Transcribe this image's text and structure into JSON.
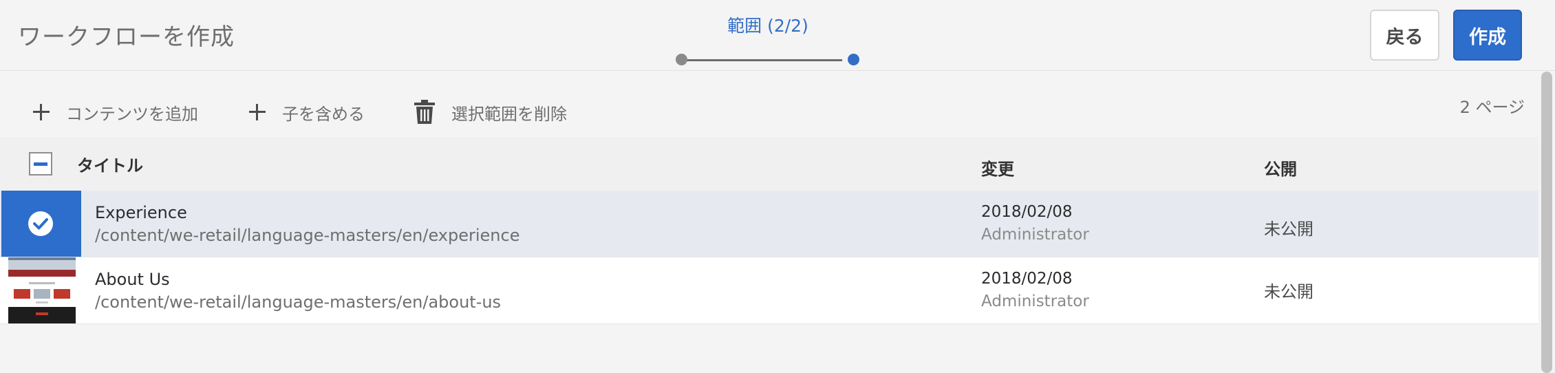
{
  "header": {
    "title": "ワークフローを作成",
    "step_label": "範囲 (2/2)",
    "back_label": "戻る",
    "create_label": "作成"
  },
  "toolbar": {
    "add_content": "コンテンツを追加",
    "include_children": "子を含める",
    "delete_selection": "選択範囲を削除",
    "page_count": "2 ページ"
  },
  "table": {
    "columns": {
      "title": "タイトル",
      "modified": "変更",
      "published": "公開"
    },
    "rows": [
      {
        "title": "Experience",
        "path": "/content/we-retail/language-masters/en/experience",
        "date": "2018/02/08",
        "user": "Administrator",
        "status": "未公開",
        "selected": true
      },
      {
        "title": "About Us",
        "path": "/content/we-retail/language-masters/en/about-us",
        "date": "2018/02/08",
        "user": "Administrator",
        "status": "未公開",
        "selected": false
      }
    ]
  },
  "colors": {
    "accent": "#2d6dcc",
    "step_label": "#326ec8",
    "selected_row": "#e6eaf0"
  }
}
